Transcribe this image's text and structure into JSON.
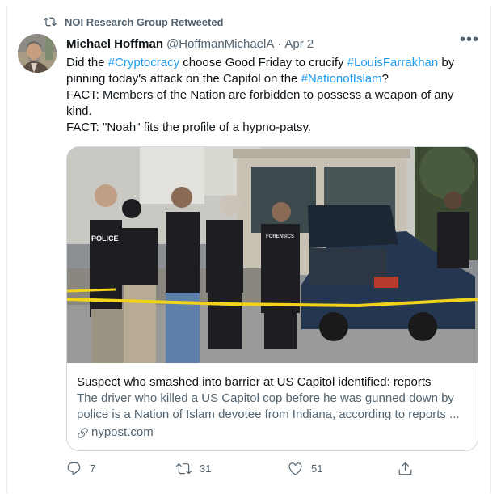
{
  "retweet_banner": {
    "label": "NOI Research Group Retweeted",
    "icon": "retweet-icon"
  },
  "author": {
    "name": "Michael Hoffman",
    "handle": "@HoffmanMichaelA",
    "separator": "·",
    "date": "Apr 2"
  },
  "more_button": {
    "label": "•••",
    "icon": "more-icon"
  },
  "tweet": {
    "line1": {
      "t1": "Did the ",
      "tag1": "#Cryptocracy",
      "t2": " choose Good Friday to crucify ",
      "tag2": "#LouisFarrakhan",
      "t3": " by pinning today's attack on the Capitol on the ",
      "tag3": "#NationofIslam",
      "t4": "?"
    },
    "fact1": "FACT: Members of the Nation are forbidden to possess a weapon of any kind.",
    "fact2": "FACT: \"Noah\" fits the profile of a hypno-patsy."
  },
  "link_card": {
    "image_labels": {
      "police": "POLICE",
      "forensics": "FORENSICS"
    },
    "title": "Suspect who smashed into barrier at US Capitol identified: reports",
    "description": "The driver who killed a US Capitol cop before he was gunned down by police is a Nation of Islam devotee from Indiana, according to reports ...",
    "domain": "nypost.com",
    "domain_icon": "link-icon"
  },
  "actions": {
    "reply": {
      "icon": "reply-icon",
      "count": "7"
    },
    "retweet": {
      "icon": "retweet-icon",
      "count": "31"
    },
    "like": {
      "icon": "heart-icon",
      "count": "51"
    },
    "share": {
      "icon": "share-icon"
    }
  },
  "colors": {
    "link_blue": "#1d9bf0",
    "secondary_text": "#536471",
    "primary_text": "#0f1419",
    "border": "#cfd9de",
    "police_tape": "#f2d31b"
  }
}
